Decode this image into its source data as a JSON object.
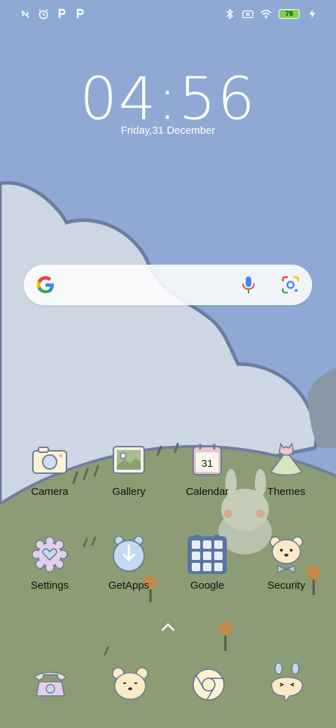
{
  "status_bar": {
    "battery_level": "79",
    "icons_left": [
      "vibrate-off-icon",
      "alarm-icon",
      "parking-icon",
      "parking-icon"
    ],
    "icons_right": [
      "bluetooth-icon",
      "no-sim-icon",
      "wifi-icon",
      "battery-icon",
      "charging-icon"
    ]
  },
  "lockscreen": {
    "time": "04:56",
    "date": "Friday,31 December"
  },
  "search": {
    "icons": [
      "google-g-icon",
      "microphone-icon",
      "google-lens-icon"
    ]
  },
  "apps": {
    "row1": [
      {
        "label": "Camera",
        "icon": "camera-icon"
      },
      {
        "label": "Gallery",
        "icon": "gallery-icon"
      },
      {
        "label": "Calendar",
        "icon": "calendar-icon",
        "badge": "31"
      },
      {
        "label": "Themes",
        "icon": "dress-icon"
      }
    ],
    "row2": [
      {
        "label": "Settings",
        "icon": "gear-heart-icon"
      },
      {
        "label": "GetApps",
        "icon": "getapps-icon"
      },
      {
        "label": "Google",
        "icon": "google-folder-icon"
      },
      {
        "label": "Security",
        "icon": "bear-bowtie-icon"
      }
    ]
  },
  "dock": {
    "apps": [
      "phone-icon",
      "bear-face-icon",
      "chrome-icon",
      "messaging-bunny-icon"
    ]
  },
  "colors": {
    "sky": "#8fa9d4",
    "cloud": "#cdd7e3",
    "grass": "#8c9c74",
    "accent_green": "#79d54d"
  }
}
